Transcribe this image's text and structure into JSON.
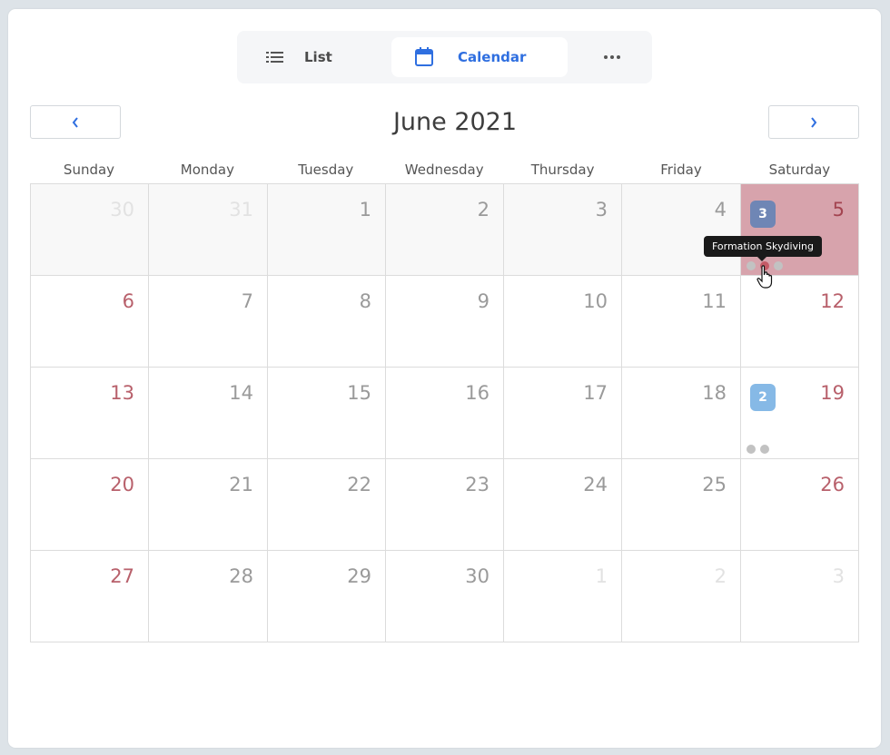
{
  "view_switcher": {
    "list_label": "List",
    "calendar_label": "Calendar",
    "active": "Calendar",
    "more_icon": "more-horizontal-icon",
    "accent_color": "#2f6fe0"
  },
  "header": {
    "month_title": "June 2021",
    "prev_icon": "chevron-left-icon",
    "next_icon": "chevron-right-icon"
  },
  "weekdays": [
    "Sunday",
    "Monday",
    "Tuesday",
    "Wednesday",
    "Thursday",
    "Friday",
    "Saturday"
  ],
  "weeks": [
    [
      {
        "day": "30",
        "state": "other past"
      },
      {
        "day": "31",
        "state": "other past"
      },
      {
        "day": "1",
        "state": "past"
      },
      {
        "day": "2",
        "state": "past"
      },
      {
        "day": "3",
        "state": "past"
      },
      {
        "day": "4",
        "state": "past"
      },
      {
        "day": "5",
        "state": "today weekend",
        "badge": "3",
        "badge_style": "dark",
        "dots": [
          "grey",
          "red",
          "grey"
        ]
      }
    ],
    [
      {
        "day": "6",
        "state": "weekend"
      },
      {
        "day": "7",
        "state": ""
      },
      {
        "day": "8",
        "state": ""
      },
      {
        "day": "9",
        "state": ""
      },
      {
        "day": "10",
        "state": ""
      },
      {
        "day": "11",
        "state": ""
      },
      {
        "day": "12",
        "state": "weekend"
      }
    ],
    [
      {
        "day": "13",
        "state": "weekend"
      },
      {
        "day": "14",
        "state": ""
      },
      {
        "day": "15",
        "state": ""
      },
      {
        "day": "16",
        "state": ""
      },
      {
        "day": "17",
        "state": ""
      },
      {
        "day": "18",
        "state": ""
      },
      {
        "day": "19",
        "state": "weekend",
        "badge": "2",
        "badge_style": "light",
        "dots": [
          "grey",
          "grey"
        ]
      }
    ],
    [
      {
        "day": "20",
        "state": "weekend"
      },
      {
        "day": "21",
        "state": ""
      },
      {
        "day": "22",
        "state": ""
      },
      {
        "day": "23",
        "state": ""
      },
      {
        "day": "24",
        "state": ""
      },
      {
        "day": "25",
        "state": ""
      },
      {
        "day": "26",
        "state": "weekend"
      }
    ],
    [
      {
        "day": "27",
        "state": "weekend"
      },
      {
        "day": "28",
        "state": ""
      },
      {
        "day": "29",
        "state": ""
      },
      {
        "day": "30",
        "state": ""
      },
      {
        "day": "1",
        "state": "other"
      },
      {
        "day": "2",
        "state": "other"
      },
      {
        "day": "3",
        "state": "other"
      }
    ]
  ],
  "tooltip": {
    "text": "Formation Skydiving"
  },
  "colors": {
    "today_bg": "#d7a3ac",
    "weekend_text": "#b8606b",
    "event_dot_active": "#c45a66"
  }
}
